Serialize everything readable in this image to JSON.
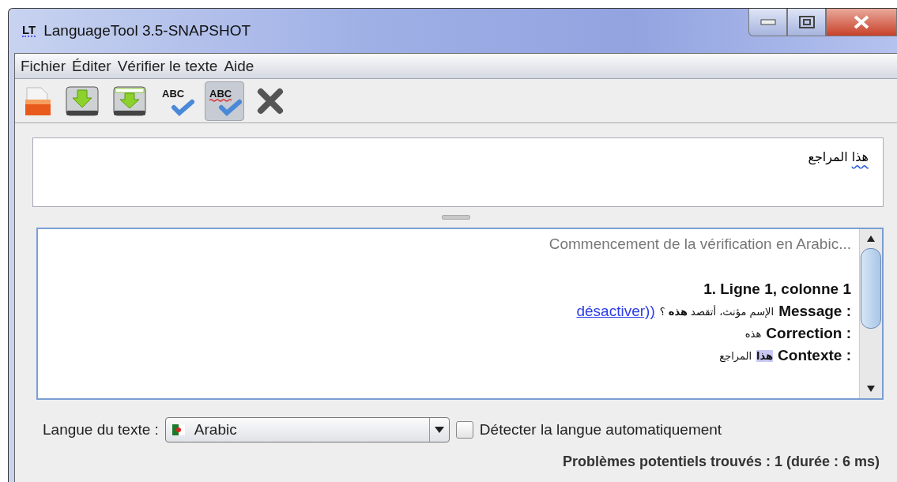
{
  "window": {
    "logo": "LT",
    "title": "LanguageTool 3.5-SNAPSHOT"
  },
  "menu": [
    "Fichier",
    "Éditer",
    "Vérifier le texte",
    "Aide"
  ],
  "toolbar": [
    {
      "kind": "open",
      "selected": false
    },
    {
      "kind": "save",
      "selected": false
    },
    {
      "kind": "saveas",
      "selected": false
    },
    {
      "kind": "check",
      "selected": false,
      "icon_text": "ABC"
    },
    {
      "kind": "autocheck",
      "selected": true,
      "icon_text": "ABC"
    },
    {
      "kind": "close",
      "selected": false
    }
  ],
  "editor": {
    "error_word": "هذا",
    "rest": "المراجع"
  },
  "results": {
    "status": "Commencement de la vérification en Arabic...",
    "heading": "1. Ligne 1, colonne 1",
    "message": {
      "label": "Message :",
      "text": "الإسم مؤنث، أتقصد **هذه** ؟",
      "link": "désactiver))"
    },
    "correction": {
      "label": "Correction :",
      "text": "هذه"
    },
    "context": {
      "label": "Contexte :",
      "error": "هذا",
      "rest": "المراجع"
    }
  },
  "language": {
    "label": "Langue du texte :",
    "value": "Arabic"
  },
  "auto_detect": {
    "label": "Détecter la langue automatiquement",
    "checked": false
  },
  "status_bar": "Problèmes potentiels trouvés : 1 (durée : 6 ms)"
}
